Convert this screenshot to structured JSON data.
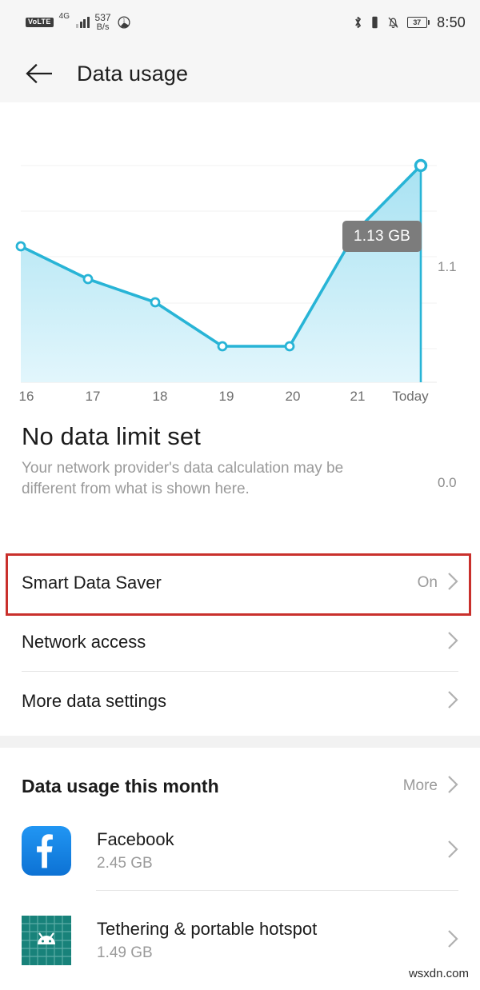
{
  "statusbar": {
    "volte_label": "VoLTE",
    "network_generation": "4G",
    "data_speed_value": "537",
    "data_speed_unit": "B/s",
    "battery_percent": "37",
    "time": "8:50",
    "icons": [
      "volte-badge",
      "signal-bars-icon",
      "data-speed-indicator",
      "data-saver-icon",
      "bluetooth-icon",
      "silent-mode-icon",
      "battery-icon"
    ]
  },
  "appbar": {
    "back_icon": "back-arrow-icon",
    "title": "Data usage"
  },
  "chart_data": {
    "type": "area",
    "title": "",
    "xlabel": "",
    "ylabel": "",
    "categories": [
      "16",
      "17",
      "18",
      "19",
      "20",
      "21",
      "Today"
    ],
    "values": [
      0.49,
      0.405,
      0.345,
      0.195,
      0.195,
      0.78,
      1.13
    ],
    "ylim": [
      0.0,
      1.1
    ],
    "ytick_labels": [
      "0.0",
      "1.1"
    ],
    "grid": true,
    "legend": "none",
    "tooltip_label": "1.13 GB",
    "tooltip_point_index": 6,
    "line_color": "#28b4d6",
    "fill_color": "#bfe8f5",
    "marker": "open-circle"
  },
  "headline": {
    "title": "No data limit set",
    "subtitle": "Your network provider's data calculation may be different from what is shown here."
  },
  "settings_rows": [
    {
      "label": "Smart Data Saver",
      "value": "On",
      "chevron": "chevron-right-icon",
      "highlighted": true
    },
    {
      "label": "Network access",
      "value": "",
      "chevron": "chevron-right-icon",
      "highlighted": false
    },
    {
      "label": "More data settings",
      "value": "",
      "chevron": "chevron-right-icon",
      "highlighted": false
    }
  ],
  "highlight_color": "#c9302c",
  "usage_section": {
    "title": "Data usage this month",
    "more_label": "More",
    "more_chevron": "chevron-right-icon",
    "apps": [
      {
        "name": "Facebook",
        "size": "2.45 GB",
        "icon": "facebook-icon",
        "icon_color": "#1787e0"
      },
      {
        "name": "Tethering & portable hotspot",
        "size": "1.49 GB",
        "icon": "android-hotspot-icon",
        "icon_color": "#18827a"
      }
    ]
  },
  "watermark": "wsxdn.com"
}
